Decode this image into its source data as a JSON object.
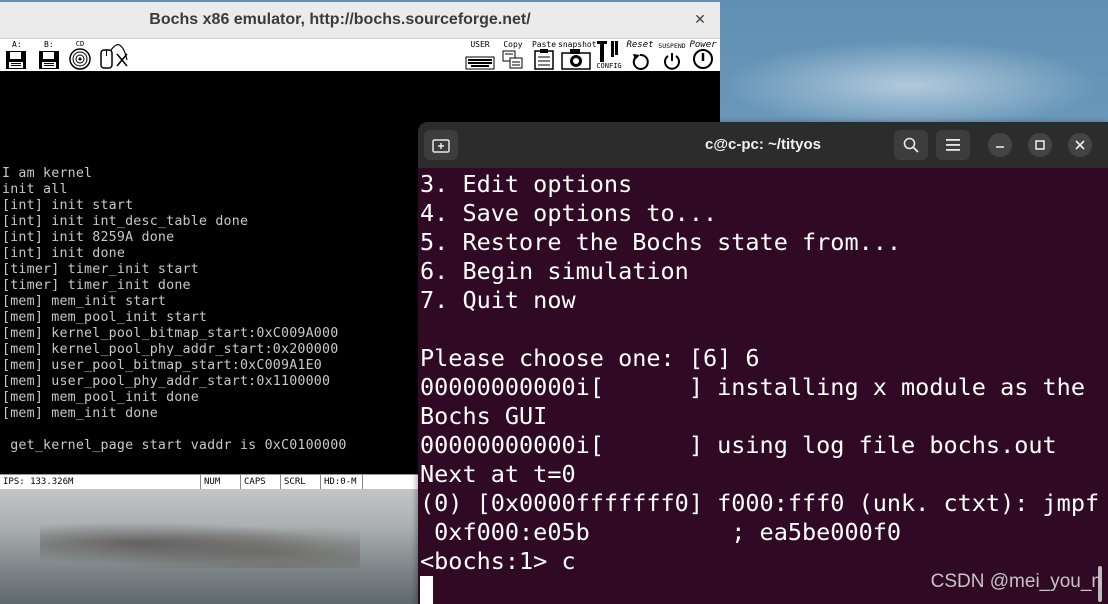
{
  "bochs": {
    "title": "Bochs x86 emulator, http://bochs.sourceforge.net/",
    "toolbar": {
      "floppy_a": "A:",
      "floppy_b": "B:",
      "cdrom": "CD",
      "user": "USER",
      "copy": "Copy",
      "paste": "Paste",
      "snapshot": "snapshot",
      "config": "CONFIG",
      "reset": "Reset",
      "suspend": "SUSPEND",
      "power": "Power"
    },
    "screen_lines": [
      "I am kernel",
      "init all",
      "[int] init start",
      "[int] init int_desc_table done",
      "[int] init 8259A done",
      "[int] init done",
      "[timer] timer_init start",
      "[timer] timer_init done",
      "[mem] mem_init start",
      "[mem] mem_pool_init start",
      "[mem] kernel_pool_bitmap_start:0xC009A000",
      "[mem] kernel_pool_phy_addr_start:0x200000",
      "[mem] user_pool_bitmap_start:0xC009A1E0",
      "[mem] user_pool_phy_addr_start:0x1100000",
      "[mem] mem_pool_init done",
      "[mem] mem_init done",
      "",
      " get_kernel_page start vaddr is 0xC0100000"
    ],
    "status": {
      "ips": "IPS: 133.326M",
      "num": "NUM",
      "caps": "CAPS",
      "scrl": "SCRL",
      "hd": "HD:0-M"
    }
  },
  "terminal": {
    "title": "c@c-pc: ~/tityos",
    "new_tab_icon": "new-tab-icon",
    "search_icon": "search-icon",
    "menu_icon": "hamburger-menu-icon",
    "lines": [
      "3. Edit options",
      "4. Save options to...",
      "5. Restore the Bochs state from...",
      "6. Begin simulation",
      "7. Quit now",
      "",
      "Please choose one: [6] 6",
      "00000000000i[      ] installing x module as the",
      "Bochs GUI",
      "00000000000i[      ] using log file bochs.out",
      "Next at t=0",
      "(0) [0x0000fffffff0] f000:fff0 (unk. ctxt): jmpf",
      " 0xf000:e05b          ; ea5be000f0",
      "<bochs:1> c"
    ],
    "watermark": "CSDN @mei_you_n"
  },
  "colors": {
    "terminal_bg": "#300a24",
    "titlebar_dark": "#2c2c2c",
    "bochs_screen": "#000000"
  }
}
